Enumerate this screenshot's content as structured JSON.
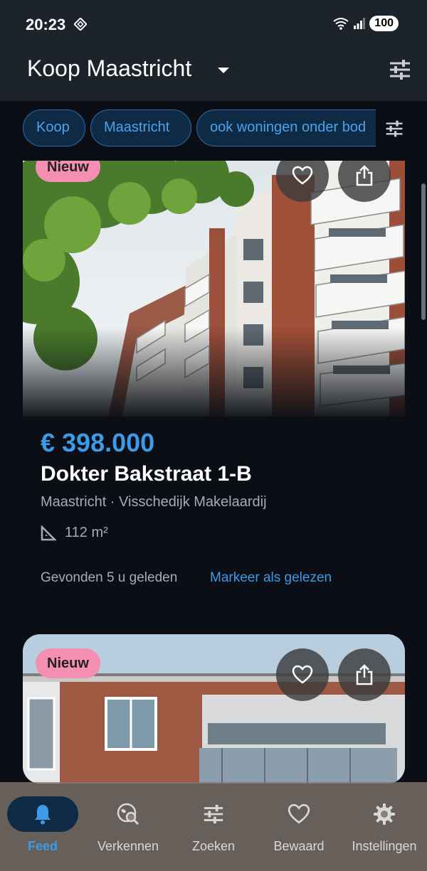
{
  "status_bar": {
    "time": "20:23",
    "battery": "100"
  },
  "app_bar": {
    "title": "Koop Maastricht"
  },
  "filter_chips": [
    "Koop",
    "Maastricht",
    "ook woningen onder bod"
  ],
  "listings": [
    {
      "badge": "Nieuw",
      "price": "€ 398.000",
      "address": "Dokter Bakstraat 1-B",
      "subtitle": "Maastricht · Visschedijk Makelaardij",
      "area": "112 m²",
      "found": "Gevonden 5 u geleden",
      "action": "Markeer als gelezen"
    },
    {
      "badge": "Nieuw"
    }
  ],
  "bottom_nav": [
    {
      "label": "Feed",
      "icon": "bell-icon",
      "active": true
    },
    {
      "label": "Verkennen",
      "icon": "explore-icon",
      "active": false
    },
    {
      "label": "Zoeken",
      "icon": "tune-icon",
      "active": false
    },
    {
      "label": "Bewaard",
      "icon": "heart-icon",
      "active": false
    },
    {
      "label": "Instellingen",
      "icon": "gear-icon",
      "active": false
    }
  ],
  "colors": {
    "accent": "#3b9be8",
    "badge": "#f48fb1",
    "background": "#0b0f15",
    "appbar": "#1c232b"
  }
}
